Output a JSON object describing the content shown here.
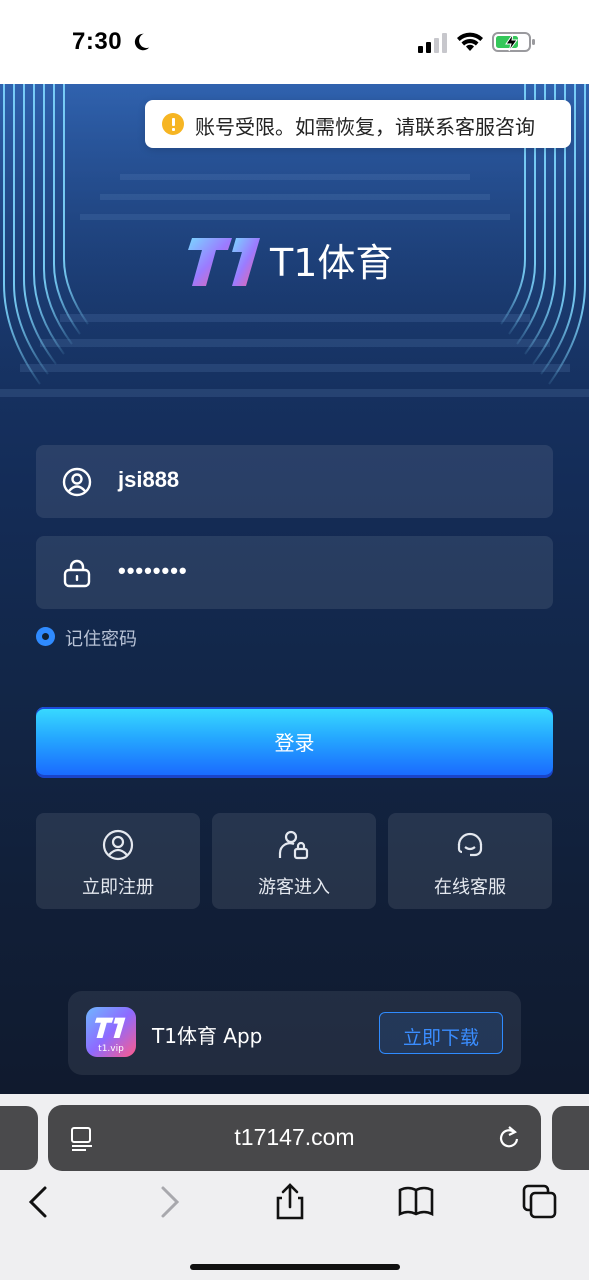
{
  "status_bar": {
    "time": "7:30",
    "icons": [
      "moon-icon",
      "cellular-signal-icon",
      "wifi-icon",
      "battery-charging-icon"
    ],
    "battery_color": "#34c759"
  },
  "toast": {
    "message": "账号受限。如需恢复，请联系客服咨询",
    "icon": "warning-icon",
    "icon_color": "#f6b523"
  },
  "brand": {
    "logo_text": "T1",
    "name": "T1体育"
  },
  "login_form": {
    "username": {
      "icon": "user-icon",
      "value": "jsi888"
    },
    "password": {
      "icon": "lock-icon",
      "value": "••••••••"
    },
    "remember_label": "记住密码",
    "remember_checked": true,
    "submit_label": "登录"
  },
  "quick_actions": [
    {
      "label": "立即注册",
      "icon": "user-circle-icon"
    },
    {
      "label": "游客进入",
      "icon": "guest-user-icon"
    },
    {
      "label": "在线客服",
      "icon": "headset-icon"
    }
  ],
  "app_banner": {
    "app_name": "T1体育 App",
    "icon_domain": "t1.vip",
    "download_label": "立即下载"
  },
  "browser": {
    "url": "t17147.com",
    "nav_icons": [
      "back-icon",
      "forward-icon",
      "share-icon",
      "bookmarks-icon",
      "tabs-icon"
    ]
  },
  "colors": {
    "accent": "#2f8bff",
    "button_gradient_top": "#39dcff",
    "button_gradient_bottom": "#1a6bff",
    "background_dark": "#101a2e"
  }
}
